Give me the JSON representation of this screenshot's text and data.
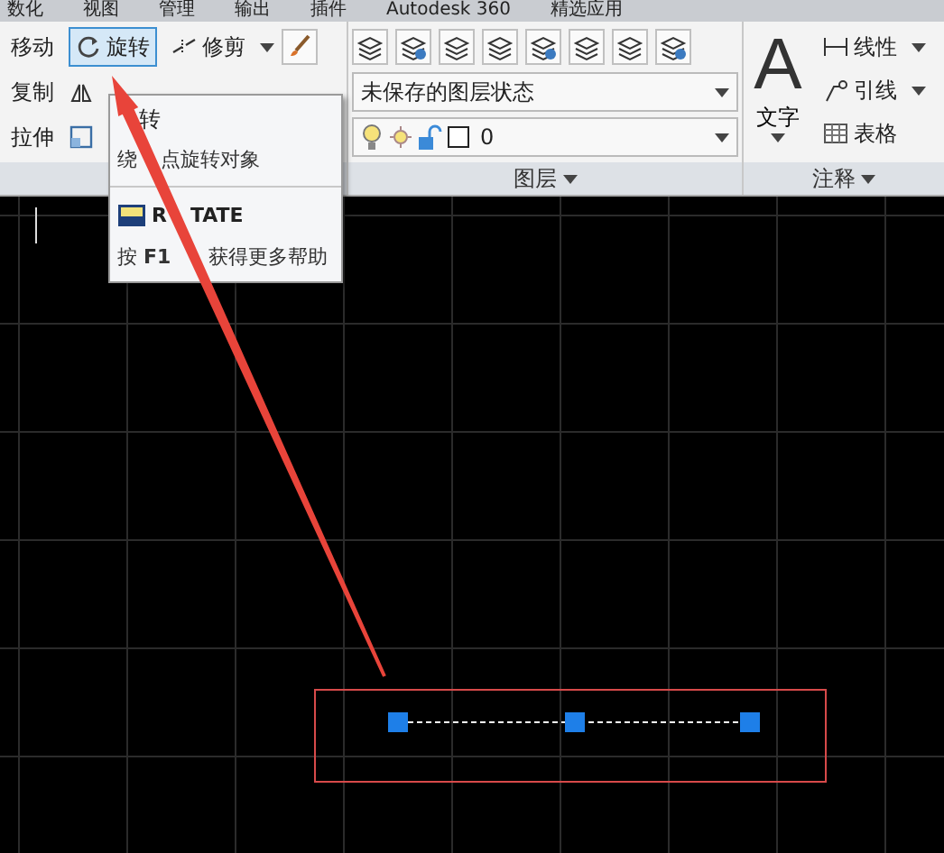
{
  "menu_tabs": [
    "数化",
    "视图",
    "管理",
    "输出",
    "插件",
    "Autodesk 360",
    "精选应用"
  ],
  "modify_panel": {
    "rows": [
      [
        {
          "label": "移动",
          "selected": false
        },
        {
          "label": "旋转",
          "selected": true
        },
        {
          "label": "修剪",
          "selected": false
        }
      ],
      [
        {
          "label": "复制",
          "selected": false
        }
      ],
      [
        {
          "label": "拉伸",
          "selected": false
        }
      ]
    ]
  },
  "layers_panel": {
    "layer_state": "未保存的图层状态",
    "current_layer": "0",
    "title": "图层"
  },
  "annotation_panel": {
    "text_icon": "A",
    "text_tool": "文字",
    "tools": [
      "线性",
      "引线",
      "表格"
    ],
    "title": "注释"
  },
  "tooltip": {
    "title": "转",
    "description": [
      "绕",
      "点旋转对象"
    ],
    "command": [
      "R",
      "TATE"
    ],
    "help": [
      "按 **F1**",
      "获得更多帮助"
    ]
  }
}
